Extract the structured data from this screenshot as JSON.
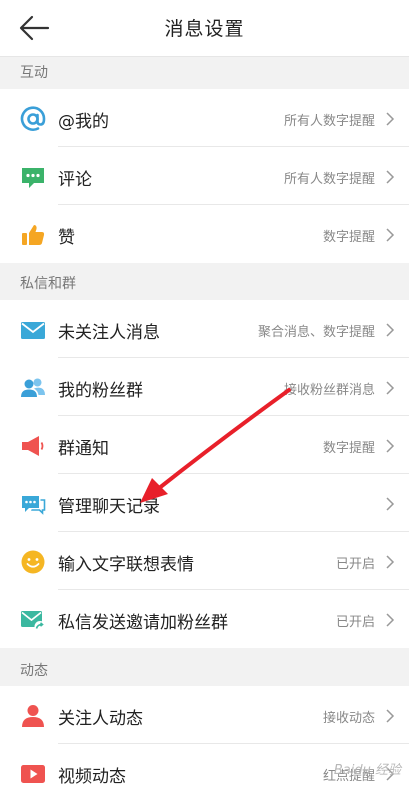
{
  "header": {
    "title": "消息设置",
    "back_icon": "arrow-left-icon"
  },
  "sections": {
    "interaction": "互动",
    "dm_groups": "私信和群",
    "activity": "动态"
  },
  "rows": {
    "mention": {
      "label": "@我的",
      "value": "所有人数字提醒",
      "icon": "at-icon",
      "color": "#3a9fd8"
    },
    "comment": {
      "label": "评论",
      "value": "所有人数字提醒",
      "icon": "comment-icon",
      "color": "#3bb36a"
    },
    "like": {
      "label": "赞",
      "value": "数字提醒",
      "icon": "thumbs-up-icon",
      "color": "#f5a623"
    },
    "stranger_msg": {
      "label": "未关注人消息",
      "value": "聚合消息、数字提醒",
      "icon": "envelope-icon",
      "color": "#3aa8d8"
    },
    "fan_group": {
      "label": "我的粉丝群",
      "value": "接收粉丝群消息",
      "icon": "group-icon",
      "color": "#3a9fd8"
    },
    "group_notice": {
      "label": "群通知",
      "value": "数字提醒",
      "icon": "megaphone-icon",
      "color": "#ef5350"
    },
    "chat_history": {
      "label": "管理聊天记录",
      "value": "",
      "icon": "chat-bubbles-icon",
      "color": "#3aa8d8"
    },
    "emoji_suggest": {
      "label": "输入文字联想表情",
      "value": "已开启",
      "icon": "smiley-icon",
      "color": "#f5b623"
    },
    "dm_invite": {
      "label": "私信发送邀请加粉丝群",
      "value": "已开启",
      "icon": "envelope-share-icon",
      "color": "#3bb8a0"
    },
    "follow_activity": {
      "label": "关注人动态",
      "value": "接收动态",
      "icon": "person-icon",
      "color": "#ef5350"
    },
    "video_activity": {
      "label": "视频动态",
      "value": "红点提醒",
      "icon": "video-icon",
      "color": "#ef5350"
    }
  },
  "watermark": "Baidu 经验",
  "annotation_arrow_color": "#e8202a"
}
